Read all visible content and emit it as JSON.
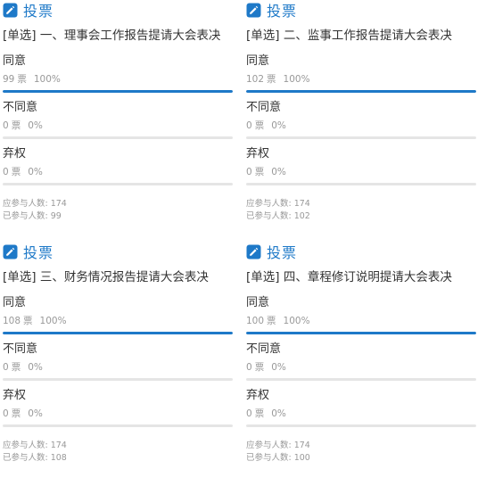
{
  "colors": {
    "accent": "#1e79c8",
    "track": "#e5e5e5",
    "muted": "#999999",
    "text": "#333333"
  },
  "icon": "edit-icon",
  "cards": [
    {
      "header": "投票",
      "question": "[单选] 一、理事会工作报告提请大会表决",
      "options": [
        {
          "label": "同意",
          "votes": "99",
          "unit": "票",
          "percent": "100%",
          "fraction": 1.0
        },
        {
          "label": "不同意",
          "votes": "0",
          "unit": "票",
          "percent": "0%",
          "fraction": 0
        },
        {
          "label": "弃权",
          "votes": "0",
          "unit": "票",
          "percent": "0%",
          "fraction": 0
        }
      ],
      "expected": "应参与人数: 174",
      "participated": "已参与人数: 99"
    },
    {
      "header": "投票",
      "question": "[单选] 二、监事工作报告提请大会表决",
      "options": [
        {
          "label": "同意",
          "votes": "102",
          "unit": "票",
          "percent": "100%",
          "fraction": 1.0
        },
        {
          "label": "不同意",
          "votes": "0",
          "unit": "票",
          "percent": "0%",
          "fraction": 0
        },
        {
          "label": "弃权",
          "votes": "0",
          "unit": "票",
          "percent": "0%",
          "fraction": 0
        }
      ],
      "expected": "应参与人数: 174",
      "participated": "已参与人数: 102"
    },
    {
      "header": "投票",
      "question": "[单选] 三、财务情况报告提请大会表决",
      "options": [
        {
          "label": "同意",
          "votes": "108",
          "unit": "票",
          "percent": "100%",
          "fraction": 1.0
        },
        {
          "label": "不同意",
          "votes": "0",
          "unit": "票",
          "percent": "0%",
          "fraction": 0
        },
        {
          "label": "弃权",
          "votes": "0",
          "unit": "票",
          "percent": "0%",
          "fraction": 0
        }
      ],
      "expected": "应参与人数: 174",
      "participated": "已参与人数: 108"
    },
    {
      "header": "投票",
      "question": "[单选] 四、章程修订说明提请大会表决",
      "options": [
        {
          "label": "同意",
          "votes": "100",
          "unit": "票",
          "percent": "100%",
          "fraction": 1.0
        },
        {
          "label": "不同意",
          "votes": "0",
          "unit": "票",
          "percent": "0%",
          "fraction": 0
        },
        {
          "label": "弃权",
          "votes": "0",
          "unit": "票",
          "percent": "0%",
          "fraction": 0
        }
      ],
      "expected": "应参与人数: 174",
      "participated": "已参与人数: 100"
    }
  ]
}
